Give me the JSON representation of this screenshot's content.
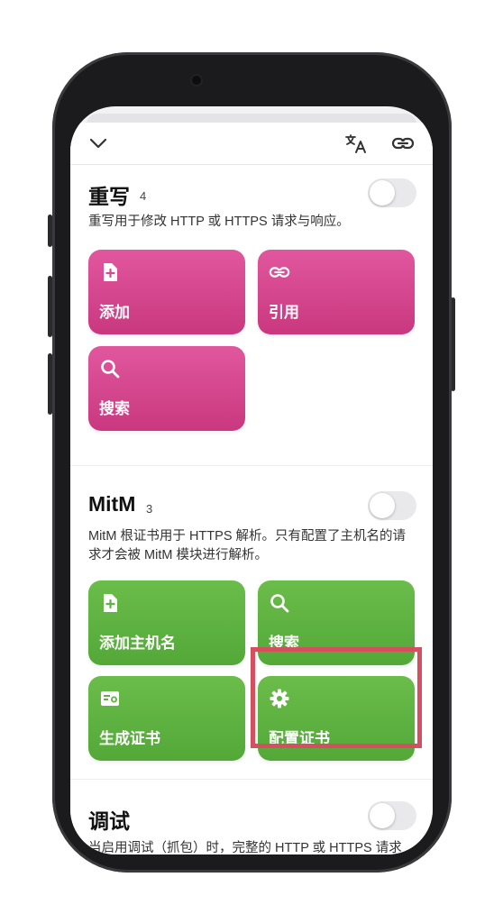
{
  "topbar": {
    "collapse_icon": "chevron-down-icon",
    "translate_icon": "translate-icon",
    "link_icon": "link-icon"
  },
  "rewrite": {
    "title": "重写",
    "count": "4",
    "description": "重写用于修改 HTTP 或 HTTPS 请求与响应。",
    "enabled": false,
    "tiles": [
      {
        "label": "添加",
        "icon": "add-file-icon"
      },
      {
        "label": "引用",
        "icon": "link-icon"
      },
      {
        "label": "搜索",
        "icon": "search-icon"
      }
    ],
    "color": "#d6498f"
  },
  "mitm": {
    "title": "MitM",
    "count": "3",
    "description": "MitM 根证书用于 HTTPS 解析。只有配置了主机名的请求才会被 MitM 模块进行解析。",
    "enabled": false,
    "tiles": [
      {
        "label": "添加主机名",
        "icon": "add-file-icon"
      },
      {
        "label": "搜索",
        "icon": "search-icon"
      },
      {
        "label": "生成证书",
        "icon": "certificate-icon"
      },
      {
        "label": "配置证书",
        "icon": "gear-icon"
      }
    ],
    "color": "#5fb342",
    "highlight_color": "#d4505e"
  },
  "debug": {
    "title": "调试",
    "description": "当启用调试（抓包）时，完整的 HTTP 或 HTTPS 请求与响应将会被记录并保存在本机，且会占用大",
    "enabled": false
  }
}
